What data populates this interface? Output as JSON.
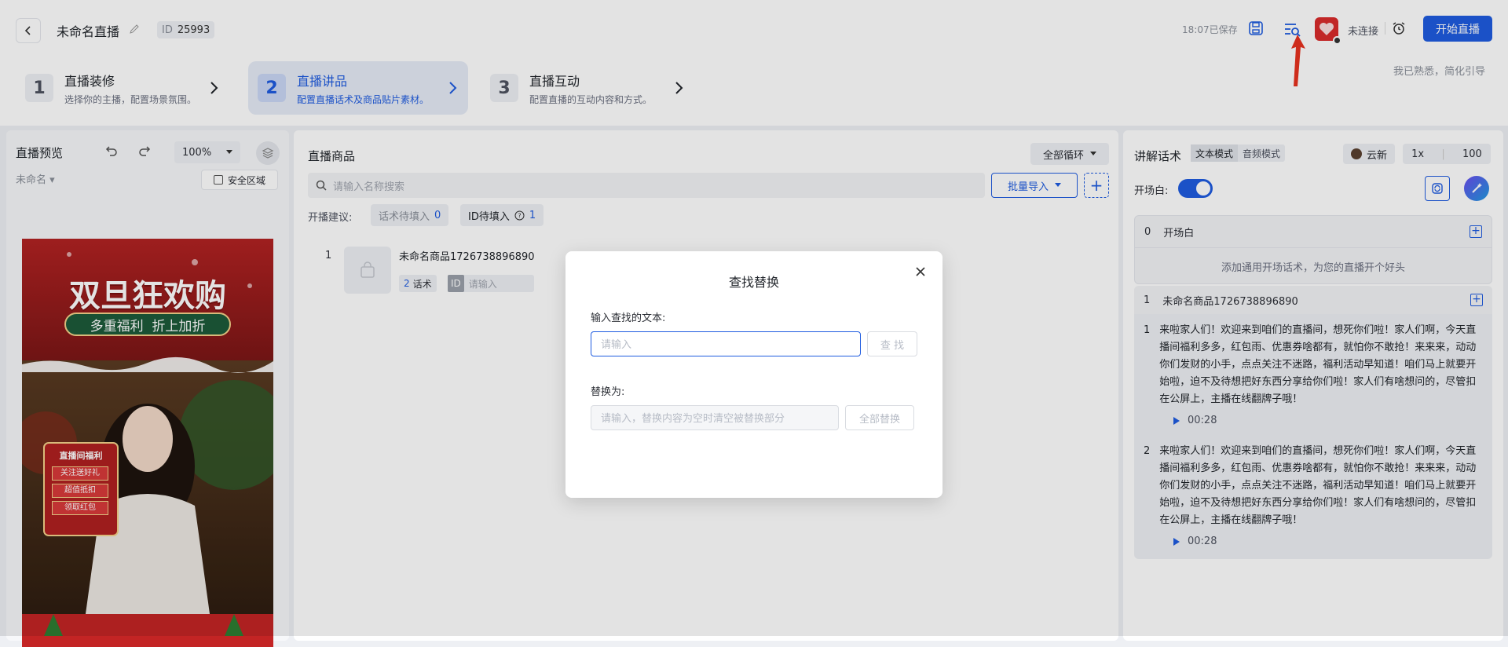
{
  "header": {
    "title": "未命名直播",
    "id_label": "ID",
    "id_value": "25993",
    "saved_text": "18:07已保存",
    "connection_status": "未连接",
    "start_label": "开始直播",
    "skip_guide": "我已熟悉，简化引导",
    "icons": [
      "back-icon",
      "edit-icon",
      "save-icon",
      "find-replace-icon",
      "avatar",
      "alarm-icon"
    ],
    "accent_color": "#1f5ce0"
  },
  "steps": [
    {
      "num": "1",
      "title": "直播装修",
      "desc": "选择你的主播，配置场景氛围。"
    },
    {
      "num": "2",
      "title": "直播讲品",
      "desc": "配置直播话术及商品贴片素材。"
    },
    {
      "num": "3",
      "title": "直播互动",
      "desc": "配置直播的互动内容和方式。"
    }
  ],
  "preview": {
    "title": "直播预览",
    "zoom": "100%",
    "name": "未命名",
    "safe_area": "安全区域",
    "poster": {
      "headline": "双旦狂欢购",
      "ribbon": "多重福利  折上加折",
      "card_title": "直播间福利",
      "card_items": [
        "关注送好礼",
        "超值抵扣",
        "领取红包"
      ]
    }
  },
  "products": {
    "title": "直播商品",
    "loop": "全部循环",
    "search_placeholder": "请输入名称搜索",
    "batch_import": "批量导入",
    "advise_label": "开播建议:",
    "chip_script": "话术待填入",
    "chip_script_count": "0",
    "chip_id": "ID待填入",
    "chip_id_count": "1",
    "items": [
      {
        "index": "1",
        "name": "未命名商品1726738896890",
        "script_count": "2",
        "script_label": "话术",
        "id_label": "ID",
        "id_placeholder": "请输入"
      }
    ]
  },
  "scripts": {
    "title": "讲解话术",
    "mode_text": "文本模式",
    "mode_audio": "音频模式",
    "voice": "云新",
    "speed": "1x",
    "volume": "100",
    "opening_label": "开场白:",
    "opening": {
      "index": "0",
      "title": "开场白",
      "hint": "添加通用开场话术，为您的直播开个好头"
    },
    "product": {
      "index": "1",
      "title": "未命名商品1726738896890",
      "paras": [
        {
          "n": "1",
          "text": "来啦家人们！欢迎来到咱们的直播间，想死你们啦！家人们啊，今天直播间福利多多，红包雨、优惠券啥都有，就怕你不敢抢！来来来，动动你们发财的小手，点点关注不迷路，福利活动早知道！咱们马上就要开始啦，迫不及待想把好东西分享给你们啦！家人们有啥想问的，尽管扣在公屏上，主播在线翻牌子哦！",
          "duration": "00:28"
        },
        {
          "n": "2",
          "text": "来啦家人们！欢迎来到咱们的直播间，想死你们啦！家人们啊，今天直播间福利多多，红包雨、优惠券啥都有，就怕你不敢抢！来来来，动动你们发财的小手，点点关注不迷路，福利活动早知道！咱们马上就要开始啦，迫不及待想把好东西分享给你们啦！家人们有啥想问的，尽管扣在公屏上，主播在线翻牌子哦！",
          "duration": "00:28"
        }
      ]
    }
  },
  "modal": {
    "title": "查找替换",
    "find_label": "输入查找的文本:",
    "find_placeholder": "请输入",
    "find_button": "查 找",
    "replace_label": "替换为:",
    "replace_placeholder": "请输入，替换内容为空时清空被替换部分",
    "replace_button": "全部替换"
  }
}
